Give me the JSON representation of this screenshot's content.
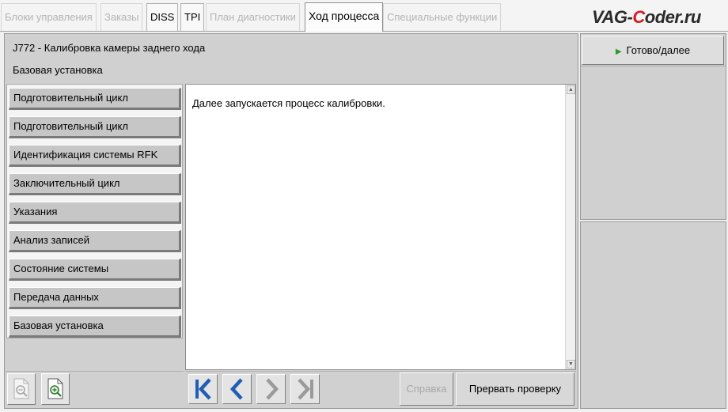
{
  "tabs": [
    {
      "label": "Блоки управления",
      "state": "disabled"
    },
    {
      "label": "Заказы",
      "state": "disabled"
    },
    {
      "label": "DISS",
      "state": "enabled"
    },
    {
      "label": "TPI",
      "state": "enabled"
    },
    {
      "label": "План диагностики",
      "state": "disabled"
    },
    {
      "label": "Ход процесса",
      "state": "active"
    },
    {
      "label": "Специальные функции",
      "state": "disabled"
    }
  ],
  "logo": {
    "part1": "VAG-",
    "part2": "C",
    "part3": "oder.ru"
  },
  "header": {
    "title": "J772 - Калибровка камеры заднего хода",
    "subtitle": "Базовая установка"
  },
  "steps": [
    {
      "label": "Подготовительный цикл"
    },
    {
      "label": "Подготовительный цикл"
    },
    {
      "label": "Идентификация системы RFK"
    },
    {
      "label": "Заключительный цикл"
    },
    {
      "label": "Указания"
    },
    {
      "label": "Анализ записей"
    },
    {
      "label": "Состояние системы"
    },
    {
      "label": "Передача данных"
    },
    {
      "label": "Базовая установка"
    }
  ],
  "content": {
    "message": "Далее запускается процесс калибровки."
  },
  "toolbar": {
    "zoom_out_icon": "zoom-out-icon",
    "zoom_in_icon": "zoom-in-icon",
    "nav_icons": [
      "skip-to-first-icon",
      "previous-icon",
      "next-icon",
      "skip-to-last-icon"
    ],
    "help_label": "Справка",
    "abort_label": "Прервать проверку"
  },
  "right_panel": {
    "ready_label": "Готово/далее"
  },
  "colors": {
    "logo_accent": "#d71920",
    "nav_blue": "#1e5fb4",
    "nav_disabled": "#9a9a9a",
    "play_green": "#2a9a2a"
  }
}
